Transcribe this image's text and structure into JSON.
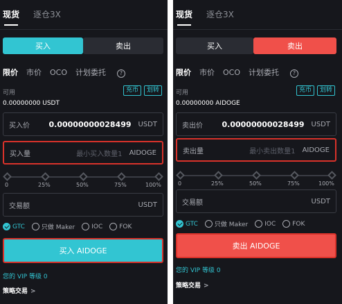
{
  "tabs": [
    "现货",
    "逐仓3X"
  ],
  "side": {
    "buy": "买入",
    "sell": "卖出"
  },
  "order_types": [
    "限价",
    "市价",
    "OCO",
    "计划委托"
  ],
  "help_icon": "?",
  "available_label": "可用",
  "deposit": "充币",
  "transfer": "划转",
  "left": {
    "balance": "0.00000000 USDT",
    "price_label": "买入价",
    "price_value": "0.00000000028499",
    "price_unit": "USDT",
    "amount_label": "买入量",
    "amount_placeholder": "最小买入数量1",
    "amount_unit": "AIDOGE",
    "total_label": "交易额",
    "total_unit": "USDT",
    "submit": "买入 AIDOGE",
    "accent": "#32c5d2"
  },
  "right": {
    "balance": "0.00000000 AIDOGE",
    "price_label": "卖出价",
    "price_value": "0.00000000028499",
    "price_unit": "USDT",
    "amount_label": "卖出量",
    "amount_placeholder": "最小卖出数量1",
    "amount_unit": "AIDOGE",
    "total_label": "交易额",
    "total_unit": "USDT",
    "submit": "卖出 AIDOGE",
    "accent": "#f0504a"
  },
  "slider_labels": [
    "0",
    "25%",
    "50%",
    "75%",
    "100%"
  ],
  "time_in_force": [
    "GTC",
    "只做 Maker",
    "IOC",
    "FOK"
  ],
  "vip": "您的 VIP 等级 0",
  "strategy": "策略交易",
  "chevron": ">"
}
